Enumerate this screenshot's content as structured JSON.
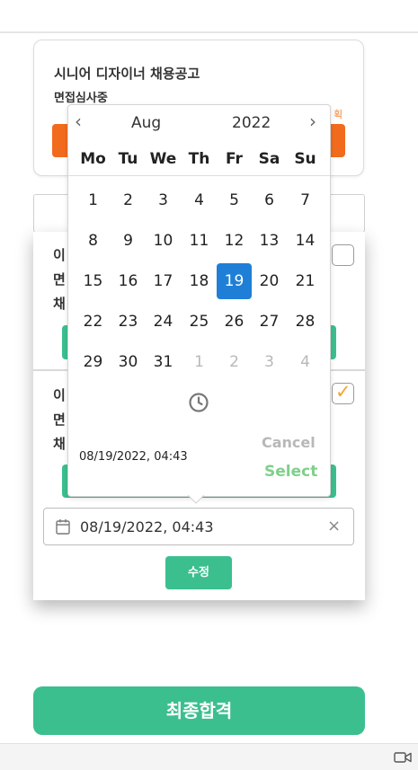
{
  "job_card": {
    "title": "시니어 디자이너 채용공고",
    "status": "면접심사중",
    "orange_text": "획"
  },
  "candidates": [
    {
      "lines": [
        "이",
        "면",
        "채"
      ],
      "checked": false
    },
    {
      "lines": [
        "이",
        "면",
        "채"
      ],
      "checked": true,
      "check_glyph": "✓"
    }
  ],
  "date_field": {
    "value": "08/19/2022, 04:43",
    "clear": "×",
    "icon": "calendar-icon"
  },
  "modify_button": "수정",
  "datepicker": {
    "prev": "‹",
    "next": "›",
    "month": "Aug",
    "year": "2022",
    "weekdays": [
      "Mo",
      "Tu",
      "We",
      "Th",
      "Fr",
      "Sa",
      "Su"
    ],
    "weeks": [
      [
        "1",
        "2",
        "3",
        "4",
        "5",
        "6",
        "7"
      ],
      [
        "8",
        "9",
        "10",
        "11",
        "12",
        "13",
        "14"
      ],
      [
        "15",
        "16",
        "17",
        "18",
        "19",
        "20",
        "21"
      ],
      [
        "22",
        "23",
        "24",
        "25",
        "26",
        "27",
        "28"
      ],
      [
        "29",
        "30",
        "31",
        "1",
        "2",
        "3",
        "4"
      ]
    ],
    "selected_day": "19",
    "current_value": "08/19/2022, 04:43",
    "cancel_label": "Cancel",
    "select_label": "Select",
    "clock_icon": "clock-icon"
  },
  "final_button": "최종합격",
  "bottom_bar": {
    "icon": "video-camera-icon"
  },
  "colors": {
    "accent_green": "#3cbf8f",
    "accent_orange": "#f26b1d",
    "selected_blue": "#1f7fd6",
    "select_text_green": "#7fd08a"
  }
}
